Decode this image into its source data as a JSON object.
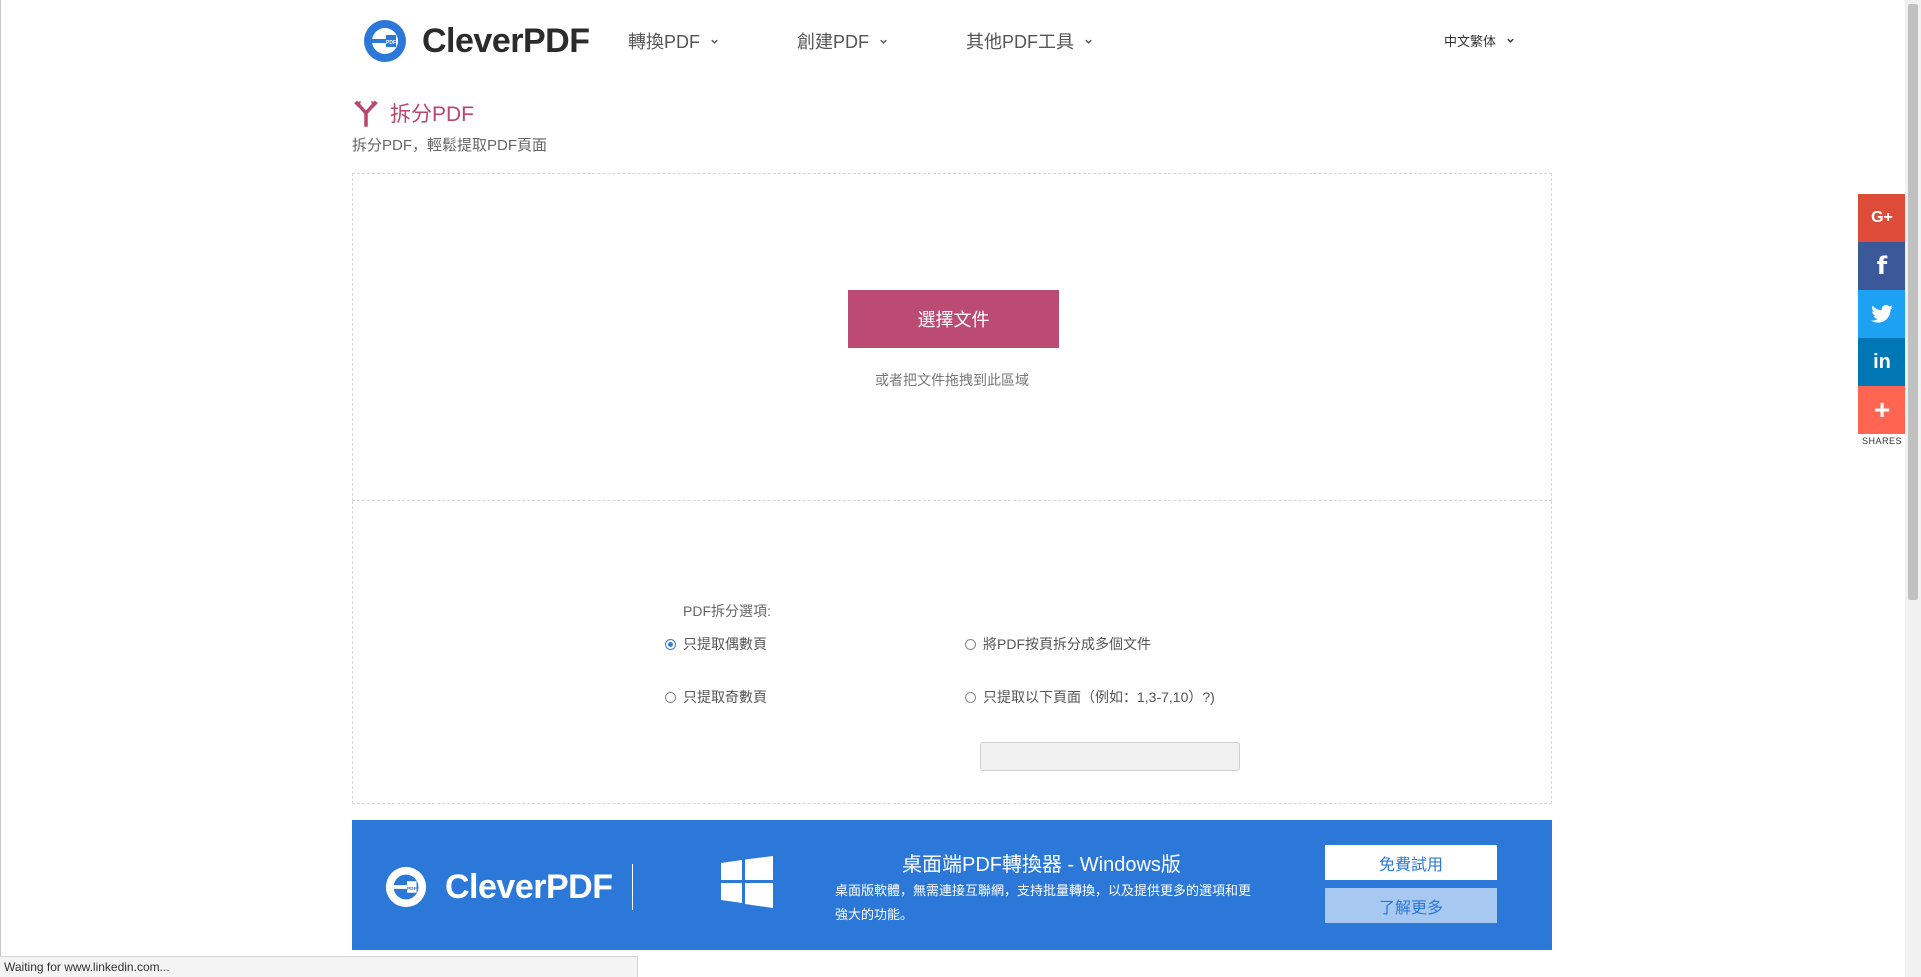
{
  "header": {
    "logo_text": "CleverPDF",
    "nav": [
      {
        "label": "轉換PDF"
      },
      {
        "label": "創建PDF"
      },
      {
        "label": "其他PDF工具"
      }
    ],
    "language": "中文繁体"
  },
  "tool": {
    "title": "拆分PDF",
    "subtitle": "拆分PDF，輕鬆提取PDF頁面"
  },
  "upload": {
    "button_label": "選擇文件",
    "hint": "或者把文件拖拽到此區域"
  },
  "options": {
    "label": "PDF拆分選項:",
    "items": [
      {
        "label": "只提取偶數頁",
        "checked": true
      },
      {
        "label": "將PDF按頁拆分成多個文件",
        "checked": false
      },
      {
        "label": "只提取奇數頁",
        "checked": false
      },
      {
        "label": "只提取以下頁面（例如：1,3-7,10）?)",
        "checked": false
      }
    ],
    "pages_input_value": ""
  },
  "banner": {
    "logo_text": "CleverPDF",
    "title": "桌面端PDF轉換器 - Windows版",
    "description": "桌面版軟體，無需連接互聯網，支持批量轉換，以及提供更多的選項和更強大的功能。",
    "trial_button": "免費試用",
    "more_button": "了解更多",
    "background_color": "#2c78d8"
  },
  "share": {
    "buttons": [
      {
        "icon": "google-plus-icon",
        "glyph": "G+",
        "color": "#dd4b39"
      },
      {
        "icon": "facebook-icon",
        "glyph": "f",
        "color": "#3b5998"
      },
      {
        "icon": "twitter-icon",
        "glyph": "t",
        "color": "#1da1f2"
      },
      {
        "icon": "linkedin-icon",
        "glyph": "in",
        "color": "#0077b5"
      },
      {
        "icon": "more-share-icon",
        "glyph": "+",
        "color": "#ff6550"
      }
    ],
    "label": "SHARES"
  },
  "status_bar": {
    "text": "Waiting for www.linkedin.com..."
  },
  "colors": {
    "accent": "#bc4b73",
    "banner": "#2c78d8"
  }
}
